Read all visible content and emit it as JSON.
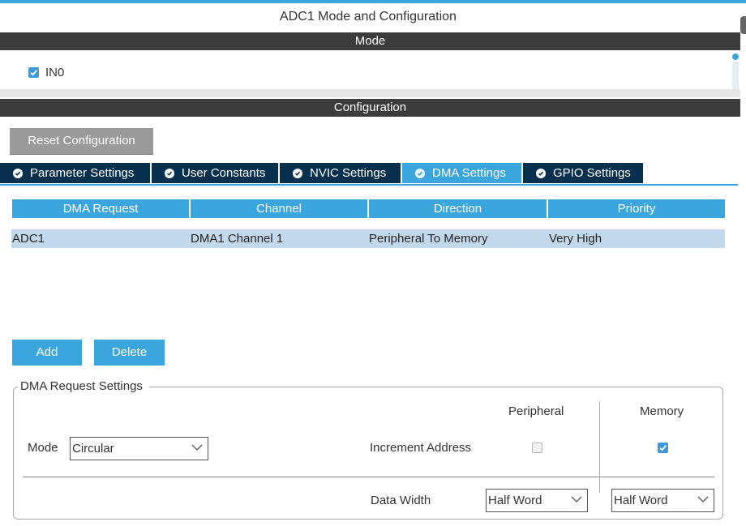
{
  "window": {
    "title": "ADC1 Mode and Configuration"
  },
  "mode_section": {
    "header": "Mode",
    "in0_label": "IN0",
    "in0_checked": true
  },
  "config_section": {
    "header": "Configuration",
    "reset_label": "Reset Configuration"
  },
  "tabs": [
    {
      "label": "Parameter Settings",
      "icon": "check-circle-icon",
      "active": false
    },
    {
      "label": "User Constants",
      "icon": "check-circle-icon",
      "active": false
    },
    {
      "label": "NVIC Settings",
      "icon": "check-circle-icon",
      "active": false
    },
    {
      "label": "DMA Settings",
      "icon": "check-circle-icon",
      "active": true
    },
    {
      "label": "GPIO Settings",
      "icon": "check-circle-icon",
      "active": false
    }
  ],
  "dma_table": {
    "columns": [
      "DMA Request",
      "Channel",
      "Direction",
      "Priority"
    ],
    "rows": [
      [
        "ADC1",
        "DMA1 Channel 1",
        "Peripheral To Memory",
        "Very High"
      ]
    ]
  },
  "buttons": {
    "add": "Add",
    "delete": "Delete"
  },
  "request_settings": {
    "legend": "DMA Request Settings",
    "mode_label": "Mode",
    "mode_value": "Circular",
    "peripheral_header": "Peripheral",
    "memory_header": "Memory",
    "increment_label": "Increment Address",
    "peripheral_increment": false,
    "memory_increment": true,
    "data_width_label": "Data Width",
    "peripheral_width": "Half Word",
    "memory_width": "Half Word"
  },
  "colors": {
    "accent": "#3aa6dd",
    "tab_dark": "#06304d",
    "header_dark": "#3c3c3c",
    "row_selected": "#c2d8ed"
  }
}
